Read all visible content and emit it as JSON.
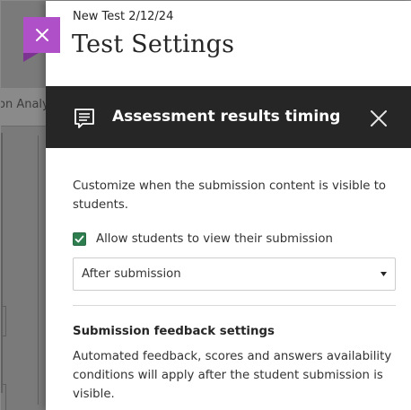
{
  "background": {
    "tab_fragment": "on Analy"
  },
  "panel": {
    "subtitle": "New Test 2/12/24",
    "title": "Test Settings"
  },
  "header_bar": {
    "title": "Assessment results timing",
    "icon": "message-feedback-icon",
    "close_icon": "close-icon"
  },
  "content": {
    "description": "Customize when the submission content is visible to students.",
    "checkbox": {
      "label": "Allow students to view their submission",
      "checked": true
    },
    "select": {
      "value": "After submission"
    },
    "feedback_heading": "Submission feedback settings",
    "feedback_description": "Automated feedback, scores and answers availability conditions will apply after the student submission is visible."
  },
  "colors": {
    "accent_purple": "#b050c8",
    "header_bar": "#262626",
    "checkbox_green": "#2d7d4e"
  }
}
